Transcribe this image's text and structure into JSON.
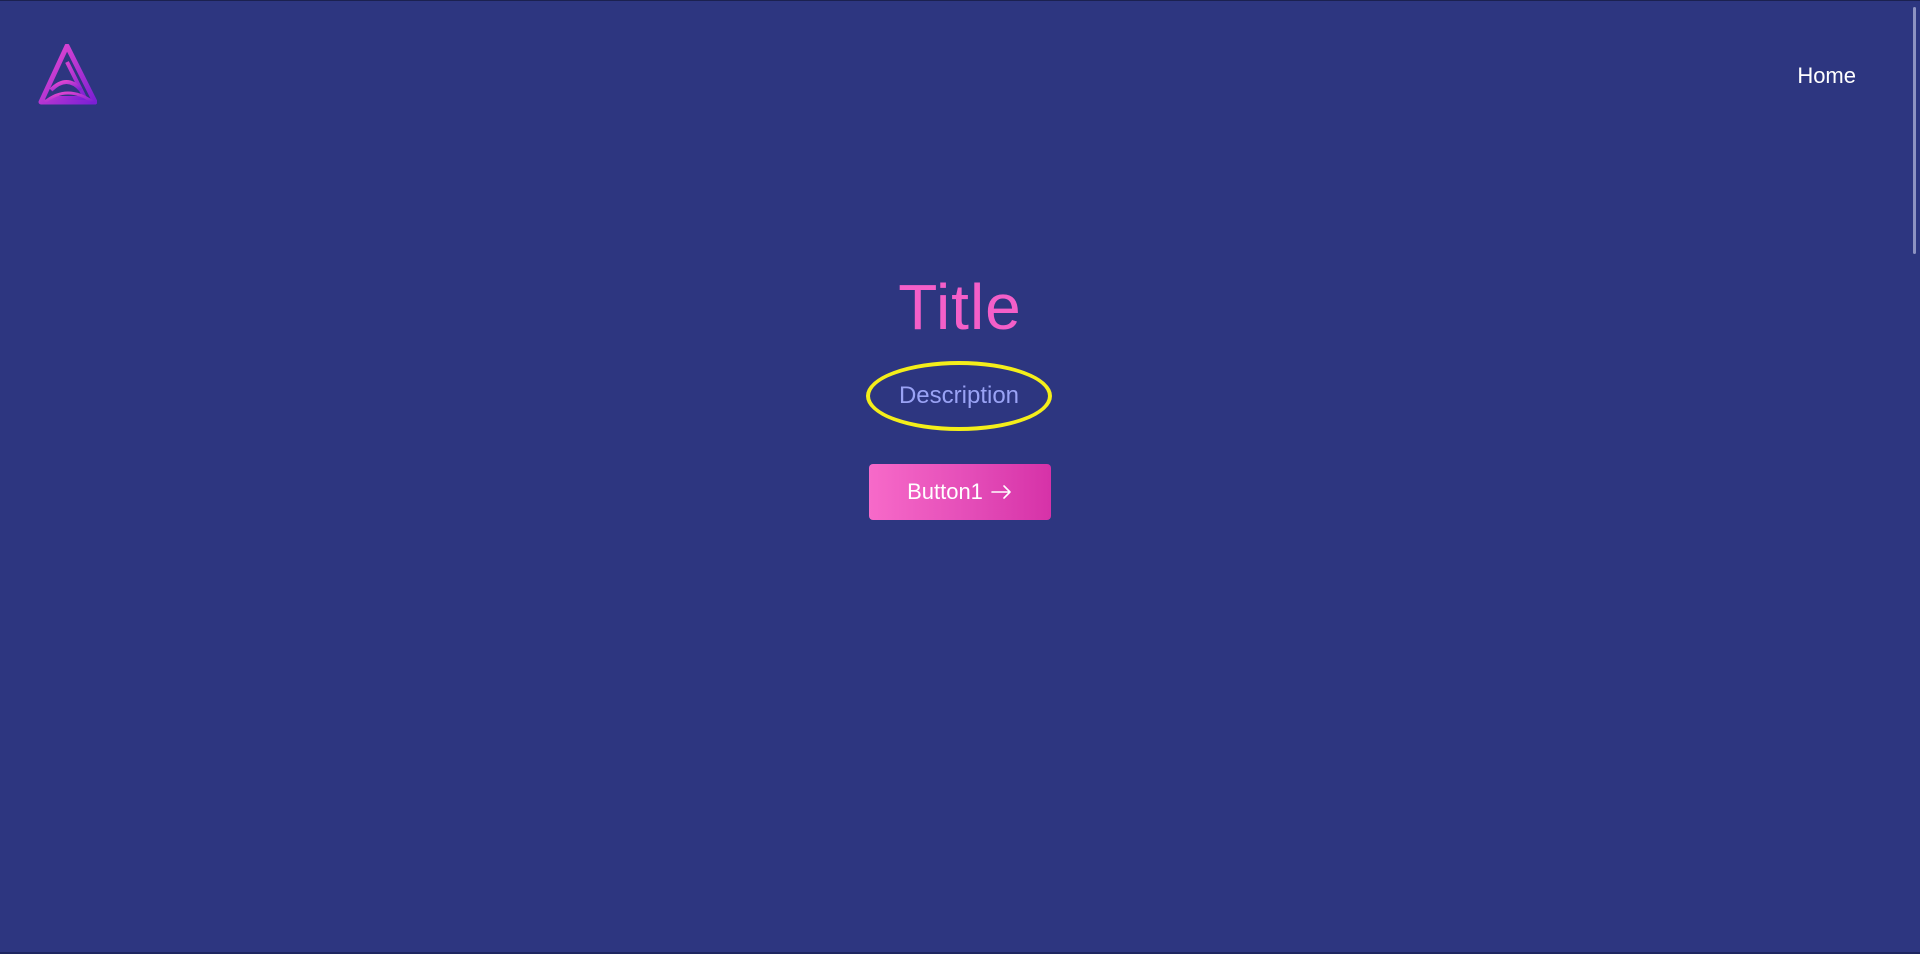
{
  "header": {
    "logo_icon": "triangle-logo-icon",
    "nav": {
      "home_label": "Home"
    }
  },
  "hero": {
    "title": "Title",
    "description": "Description",
    "button_label": "Button1",
    "button_icon": "arrow-right-icon"
  },
  "colors": {
    "background": "#2d3680",
    "title": "#f45fc8",
    "description": "#9aa3f5",
    "highlight_ring": "#f4ee1a",
    "button_gradient_start": "#f76ac9",
    "button_gradient_end": "#d632a8",
    "logo_gradient_start": "#e83fc9",
    "logo_gradient_end": "#7b1fd4"
  }
}
